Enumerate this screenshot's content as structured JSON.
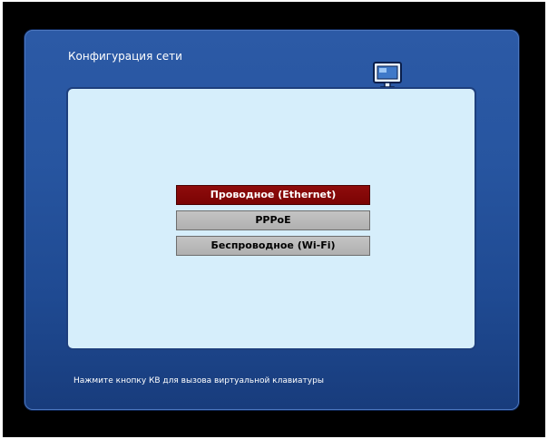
{
  "panel": {
    "title": "Конфигурация сети",
    "icon": "network-computer-icon",
    "colors": {
      "panel_top": "#2c5aa6",
      "panel_bottom": "#183c7c",
      "content_bg": "#d6eefb",
      "selected_bg": "#8f0c0c",
      "item_bg": "#b8b8b8"
    }
  },
  "menu": {
    "items": [
      {
        "label": "Проводное (Ethernet)",
        "selected": true
      },
      {
        "label": "PPPoE",
        "selected": false
      },
      {
        "label": "Беспроводное (Wi-Fi)",
        "selected": false
      }
    ]
  },
  "footer": {
    "hint": "Нажмите кнопку КВ для вызова виртуальной клавиатуры"
  }
}
